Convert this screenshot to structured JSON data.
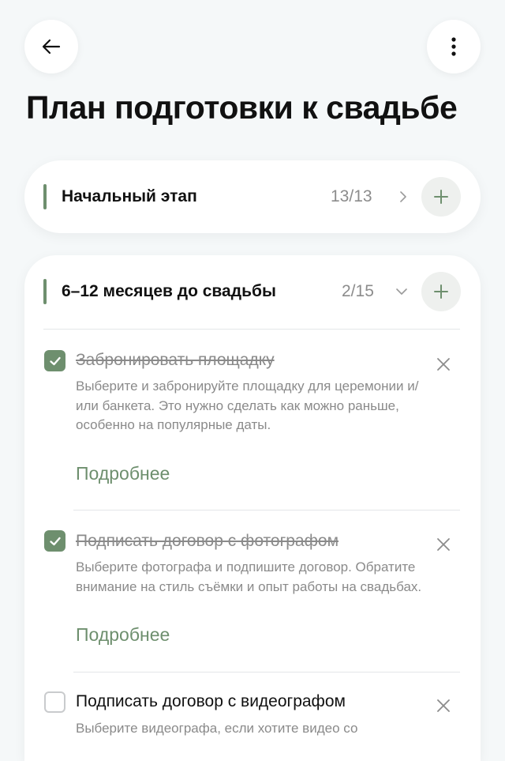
{
  "header": {
    "back_icon": "arrow-left-icon",
    "menu_icon": "more-vertical-icon",
    "title": "План подготовки к свадьбе"
  },
  "colors": {
    "accent": "#6e8f6e",
    "background": "#f5f8f9",
    "muted_text": "#8a8a8a"
  },
  "sections": [
    {
      "title": "Начальный этап",
      "count": "13/13",
      "expanded": false,
      "chevron": "chevron-right-icon",
      "add_icon": "plus-icon"
    },
    {
      "title": "6–12 месяцев до свадьбы",
      "count": "2/15",
      "expanded": true,
      "chevron": "chevron-down-icon",
      "add_icon": "plus-icon"
    }
  ],
  "tasks": [
    {
      "title": "Забронировать площадку",
      "done": true,
      "description": "Выберите и забронируйте площадку для церемонии и/или банкета. Это нужно сделать как можно раньше, особенно на популярные даты.",
      "more": "Подробнее"
    },
    {
      "title": "Подписать договор с фотографом",
      "done": true,
      "description": "Выберите фотографа и подпишите договор. Обратите внимание на стиль съёмки и опыт работы на свадьбах.",
      "more": "Подробнее"
    },
    {
      "title": "Подписать договор с видеографом",
      "done": false,
      "description": "Выберите видеографа, если хотите видео со"
    }
  ]
}
